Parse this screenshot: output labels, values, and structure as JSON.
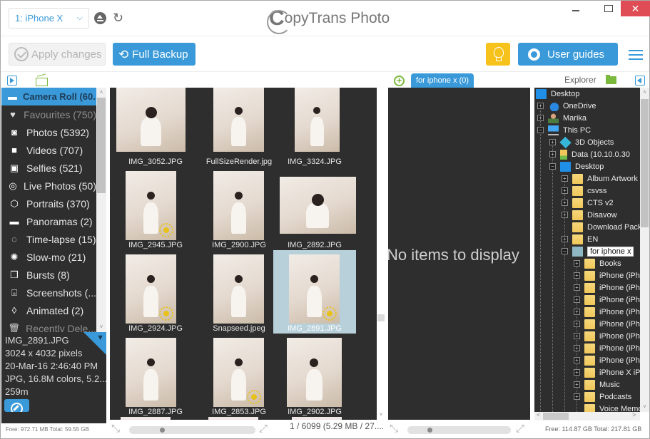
{
  "titlebar": {
    "device": "1: iPhone X",
    "app_title_initial": "C",
    "app_title_rest": "opyTrans Photo",
    "close_glyph": "✕"
  },
  "toolbar": {
    "apply_label": "Apply changes",
    "backup_label": "Full Backup",
    "guides_label": "User guides"
  },
  "subbar": {
    "destination_tab": "for iphone x (0)",
    "explorer_label": "Explorer",
    "add_glyph": "+"
  },
  "sidebar": {
    "items": [
      {
        "label": "Camera Roll (60...",
        "icon": "camera-roll-icon",
        "glyph": "▬",
        "state": "active"
      },
      {
        "label": "Favourites (750)",
        "icon": "heart-icon",
        "glyph": "♥",
        "state": "dim"
      },
      {
        "label": "Photos (5392)",
        "icon": "camera-icon",
        "glyph": "◙",
        "state": ""
      },
      {
        "label": "Videos (707)",
        "icon": "video-icon",
        "glyph": "■",
        "state": ""
      },
      {
        "label": "Selfies (521)",
        "icon": "selfie-icon",
        "glyph": "▣",
        "state": ""
      },
      {
        "label": "Live Photos (50)",
        "icon": "live-photo-icon",
        "glyph": "◎",
        "state": ""
      },
      {
        "label": "Portraits (370)",
        "icon": "cube-icon",
        "glyph": "⬡",
        "state": ""
      },
      {
        "label": "Panoramas (2)",
        "icon": "panorama-icon",
        "glyph": "▬",
        "state": ""
      },
      {
        "label": "Time-lapse (15)",
        "icon": "timelapse-icon",
        "glyph": "◌",
        "state": ""
      },
      {
        "label": "Slow-mo (21)",
        "icon": "slowmo-icon",
        "glyph": "✺",
        "state": ""
      },
      {
        "label": "Bursts (8)",
        "icon": "bursts-icon",
        "glyph": "❒",
        "state": ""
      },
      {
        "label": "Screenshots (...",
        "icon": "screenshot-icon",
        "glyph": "⌻",
        "state": ""
      },
      {
        "label": "Animated (2)",
        "icon": "animated-icon",
        "glyph": "◊",
        "state": ""
      },
      {
        "label": "Recently Dele...",
        "icon": "trash-icon",
        "glyph": "🗑",
        "state": "dim"
      }
    ]
  },
  "info": {
    "filename": "IMG_2891.JPG",
    "dimensions": "3024 x 4032 pixels",
    "date": "20-Mar-16 2:46:40 PM",
    "format": "JPG, 16.8M colors, 5.2...",
    "altitude": "259m",
    "pin_glyph": "📌"
  },
  "storage": {
    "device": "Free: 972.71 MB Total: 59.55 GB",
    "pc": "Free: 114.87 GB Total: 217.81 GB"
  },
  "grid": {
    "photos": [
      {
        "name": "IMG_3052.JPG",
        "live": false,
        "selected": false
      },
      {
        "name": "FullSizeRender.jpg",
        "live": false,
        "selected": false
      },
      {
        "name": "IMG_3324.JPG",
        "live": false,
        "selected": false
      },
      {
        "name": "IMG_2945.JPG",
        "live": true,
        "selected": false
      },
      {
        "name": "IMG_2900.JPG",
        "live": false,
        "selected": false
      },
      {
        "name": "IMG_2892.JPG",
        "live": false,
        "selected": false
      },
      {
        "name": "IMG_2924.JPG",
        "live": true,
        "selected": false
      },
      {
        "name": "Snapseed.jpeg",
        "live": false,
        "selected": false
      },
      {
        "name": "IMG_2891.JPG",
        "live": true,
        "selected": true
      },
      {
        "name": "IMG_2887.JPG",
        "live": false,
        "selected": false
      },
      {
        "name": "IMG_2853.JPG",
        "live": true,
        "selected": false
      },
      {
        "name": "IMG_2902.JPG",
        "live": false,
        "selected": false
      }
    ],
    "count_text": "1 / 6099 (5.29 MB / 27....",
    "zoom_level": 0.25
  },
  "destination": {
    "empty_text": "No items to display",
    "zoom_level": 0.2
  },
  "explorer": {
    "nodes": [
      {
        "label": "Desktop",
        "depth": 0,
        "expander": "none",
        "icon": "desktop"
      },
      {
        "label": "OneDrive",
        "depth": 1,
        "expander": "+",
        "icon": "cloud"
      },
      {
        "label": "Marika",
        "depth": 1,
        "expander": "+",
        "icon": "user"
      },
      {
        "label": "This PC",
        "depth": 1,
        "expander": "-",
        "icon": "pc"
      },
      {
        "label": "3D Objects",
        "depth": 2,
        "expander": "+",
        "icon": "3d"
      },
      {
        "label": "Data (10.10.0.30",
        "depth": 2,
        "expander": "+",
        "icon": "drive"
      },
      {
        "label": "Desktop",
        "depth": 2,
        "expander": "-",
        "icon": "desktop"
      },
      {
        "label": "Album Artwork",
        "depth": 3,
        "expander": "+",
        "icon": "folder"
      },
      {
        "label": "csvss",
        "depth": 3,
        "expander": "+",
        "icon": "folder"
      },
      {
        "label": "CTS v2",
        "depth": 3,
        "expander": "+",
        "icon": "folder"
      },
      {
        "label": "Disavow",
        "depth": 3,
        "expander": "+",
        "icon": "folder"
      },
      {
        "label": "Download Pack",
        "depth": 3,
        "expander": "none",
        "icon": "folder"
      },
      {
        "label": "EN",
        "depth": 3,
        "expander": "+",
        "icon": "folder"
      },
      {
        "label": "for iphone x",
        "depth": 3,
        "expander": "-",
        "icon": "folder-sel",
        "editing": true
      },
      {
        "label": "Books",
        "depth": 4,
        "expander": "+",
        "icon": "folder"
      },
      {
        "label": "iPhone (iPh",
        "depth": 4,
        "expander": "+",
        "icon": "folder"
      },
      {
        "label": "iPhone (iPh",
        "depth": 4,
        "expander": "+",
        "icon": "folder"
      },
      {
        "label": "iPhone (iPh",
        "depth": 4,
        "expander": "+",
        "icon": "folder"
      },
      {
        "label": "iPhone (iPh",
        "depth": 4,
        "expander": "+",
        "icon": "folder"
      },
      {
        "label": "iPhone (iPh",
        "depth": 4,
        "expander": "+",
        "icon": "folder"
      },
      {
        "label": "iPhone (iPh",
        "depth": 4,
        "expander": "+",
        "icon": "folder"
      },
      {
        "label": "iPhone (iPh",
        "depth": 4,
        "expander": "+",
        "icon": "folder"
      },
      {
        "label": "iPhone (iPh",
        "depth": 4,
        "expander": "+",
        "icon": "folder"
      },
      {
        "label": "iPhone X iP",
        "depth": 4,
        "expander": "+",
        "icon": "folder"
      },
      {
        "label": "Music",
        "depth": 4,
        "expander": "+",
        "icon": "folder"
      },
      {
        "label": "Podcasts",
        "depth": 4,
        "expander": "+",
        "icon": "folder"
      },
      {
        "label": "Voice Memo",
        "depth": 4,
        "expander": "none",
        "icon": "folder"
      }
    ]
  }
}
